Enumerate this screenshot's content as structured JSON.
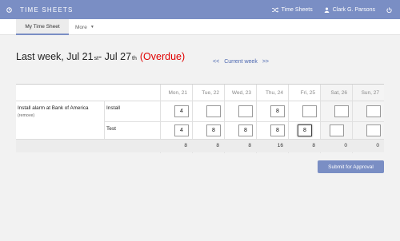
{
  "app": {
    "title": "TIME SHEETS"
  },
  "header": {
    "timesheets_link": "Time Sheets",
    "user_name": "Clark G. Parsons"
  },
  "tabs": {
    "my_timesheet": "My Time Sheet",
    "more": "More"
  },
  "week": {
    "label_start": "Last week, Jul 21",
    "start_suffix": "st",
    "label_mid": " - Jul 27",
    "end_suffix": "th",
    "status": "(Overdue)"
  },
  "nav": {
    "prev": "<<",
    "current": "Current week",
    "next": ">>"
  },
  "days": [
    "Mon, 21",
    "Tue, 22",
    "Wed, 23",
    "Thu, 24",
    "Fri, 25",
    "Sat, 26",
    "Sun, 27"
  ],
  "project": {
    "name": "Install alarm at Bank of America",
    "remove": "(remove)"
  },
  "tasks": [
    {
      "name": "Install",
      "hours": [
        "4",
        "",
        "",
        "8",
        "",
        "",
        ""
      ]
    },
    {
      "name": "Test",
      "hours": [
        "4",
        "8",
        "8",
        "8",
        "8",
        "",
        ""
      ]
    }
  ],
  "totals": [
    "8",
    "8",
    "8",
    "16",
    "8",
    "0",
    "0"
  ],
  "actions": {
    "submit": "Submit for Approval"
  },
  "colors": {
    "accent": "#7a8ec4",
    "overdue": "#e00000",
    "link": "#4a66b0"
  }
}
